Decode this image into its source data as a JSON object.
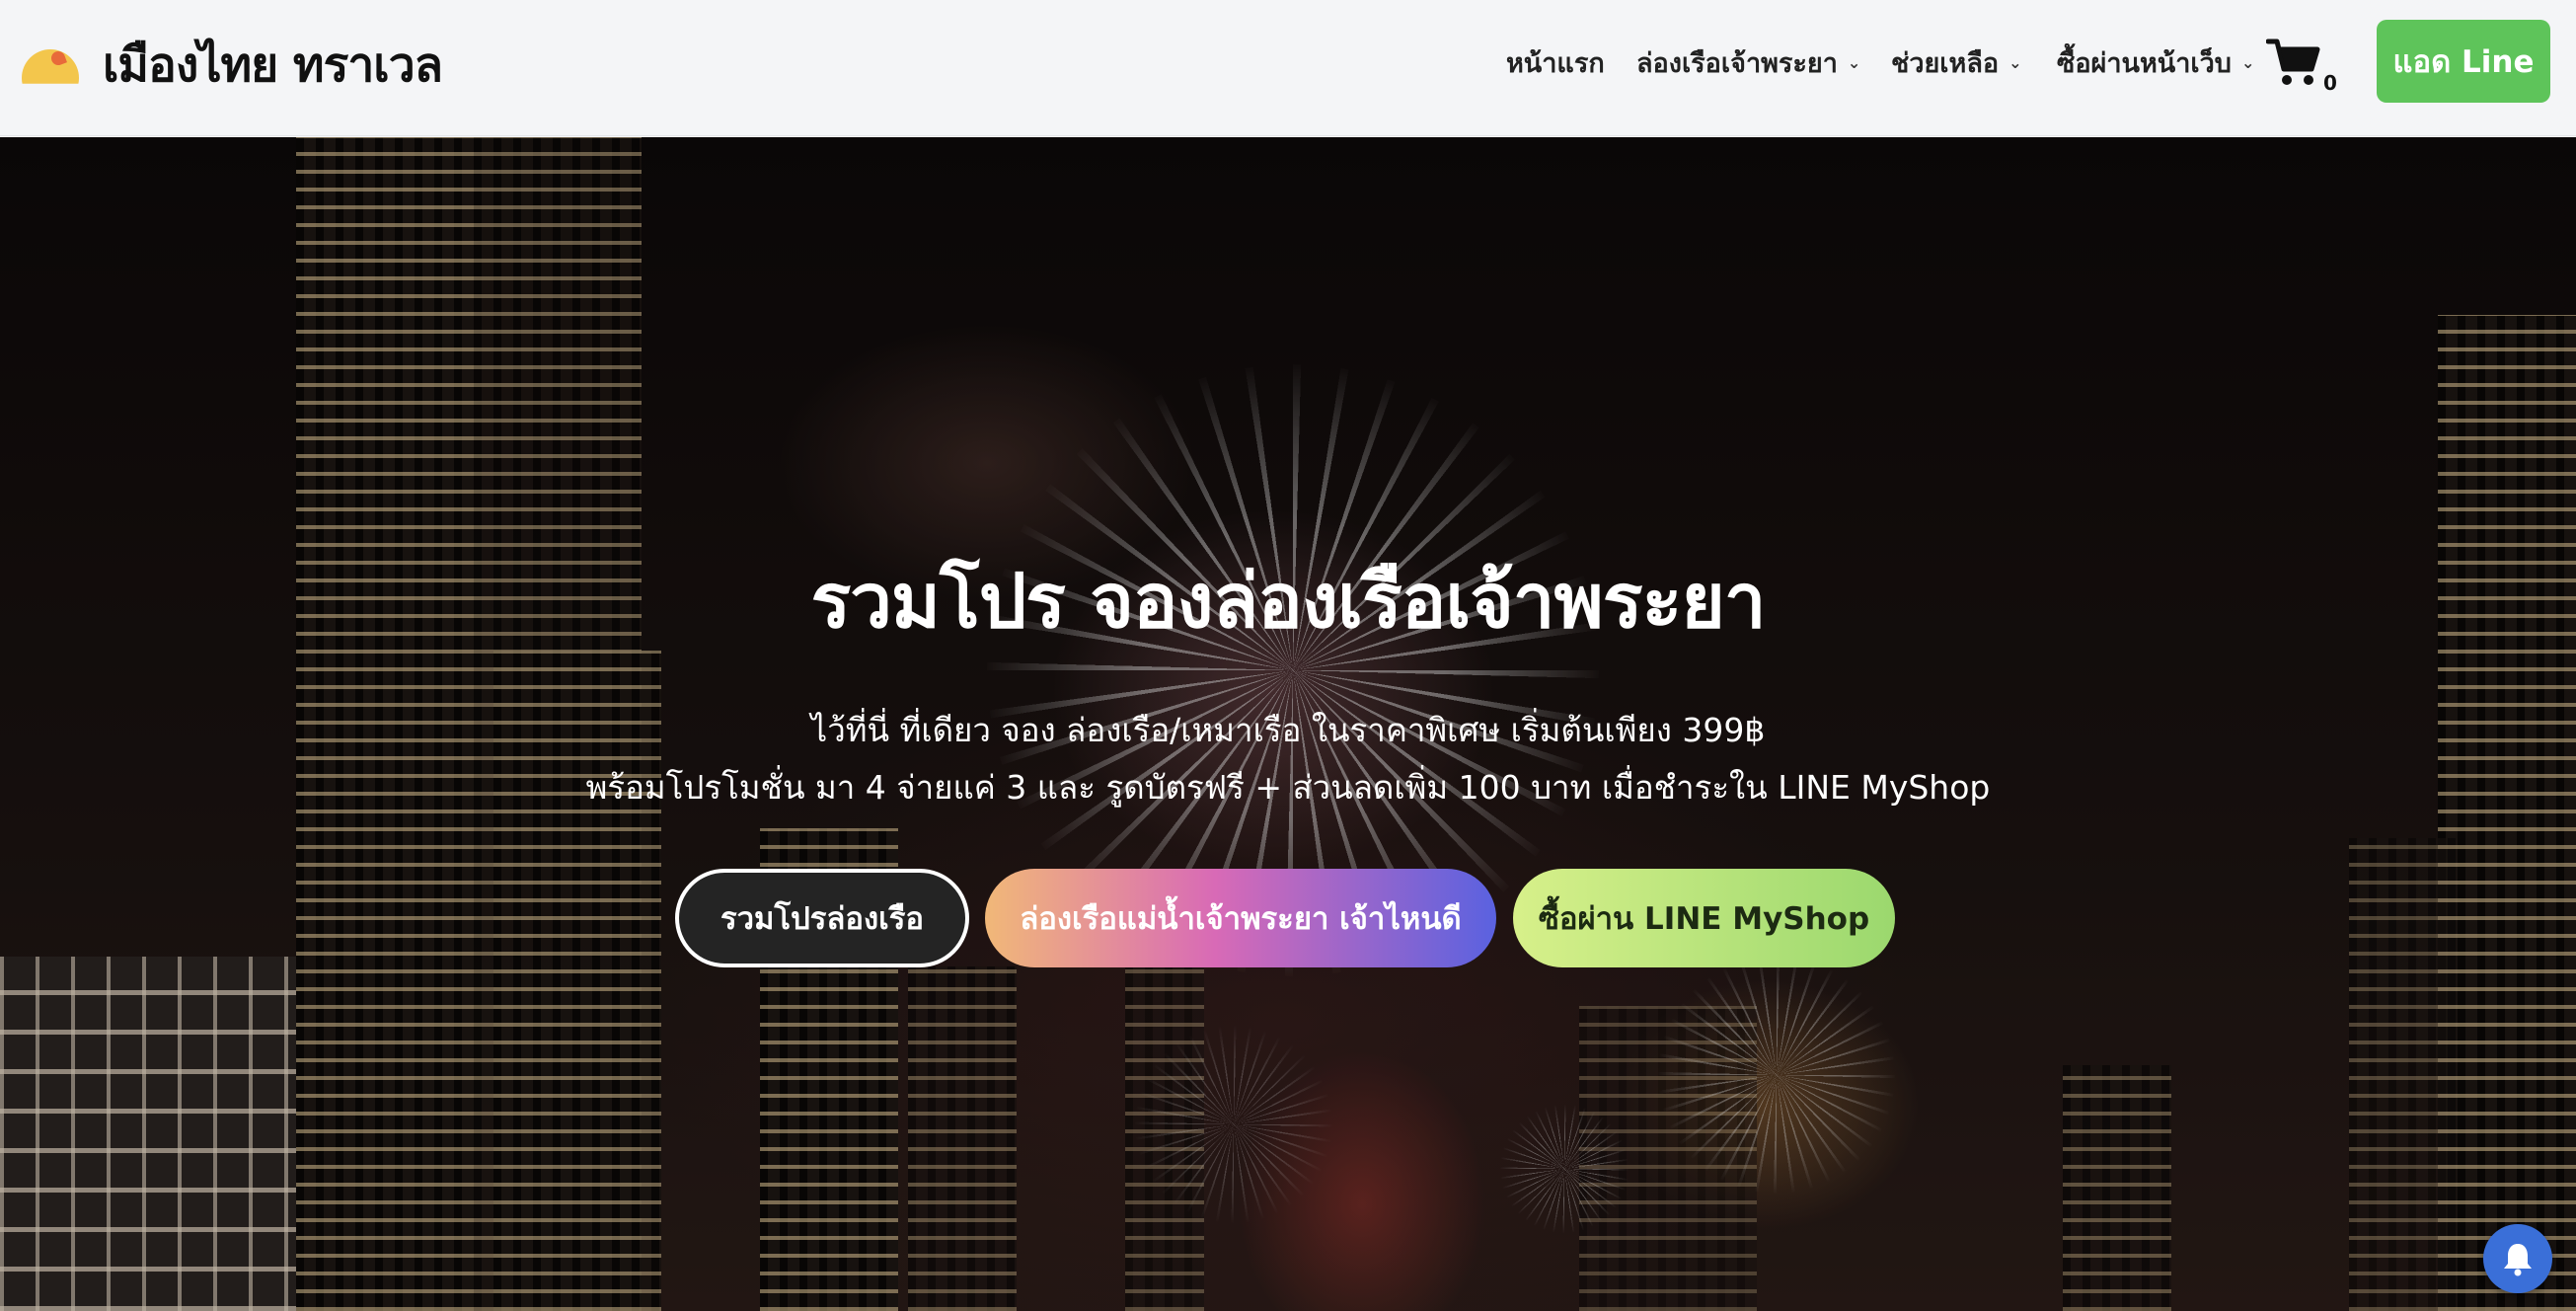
{
  "brand": {
    "name": "เมืองไทย ทราเวล",
    "logo_icon": "sun-logo-icon"
  },
  "nav": {
    "items": [
      {
        "label": "หน้าแรก",
        "has_dropdown": false
      },
      {
        "label": "ล่องเรือเจ้าพระยา",
        "has_dropdown": true
      },
      {
        "label": "ช่วยเหลือ",
        "has_dropdown": true
      },
      {
        "label": "ซื้อผ่านหน้าเว็บ",
        "has_dropdown": true
      }
    ],
    "dropdown_icon": "chevron-down-icon"
  },
  "cart": {
    "icon": "cart-icon",
    "count": "0"
  },
  "line_button": {
    "label": "แอด Line",
    "color": "#5ec45a"
  },
  "hero": {
    "title": "รวมโปร จองล่องเรือเจ้าพระยา",
    "line1": "ไว้ที่นี่ ที่เดียว จอง ล่องเรือ/เหมาเรือ ในราคาพิเศษ เริ่มต้นเพียง 399฿",
    "line2": "พร้อมโปรโมชั่น มา 4 จ่ายแค่ 3 และ รูดบัตรฟรี + ส่วนลดเพิ่ม 100 บาท เมื่อชำระใน LINE MyShop",
    "buttons": [
      {
        "label": "รวมโปรล่องเรือ"
      },
      {
        "label": "ล่องเรือแม่น้ำเจ้าพระยา เจ้าไหนดี"
      },
      {
        "label": "ซื้อผ่าน LINE MyShop"
      }
    ]
  },
  "notification": {
    "icon": "bell-icon",
    "color": "#3a6fd8"
  }
}
